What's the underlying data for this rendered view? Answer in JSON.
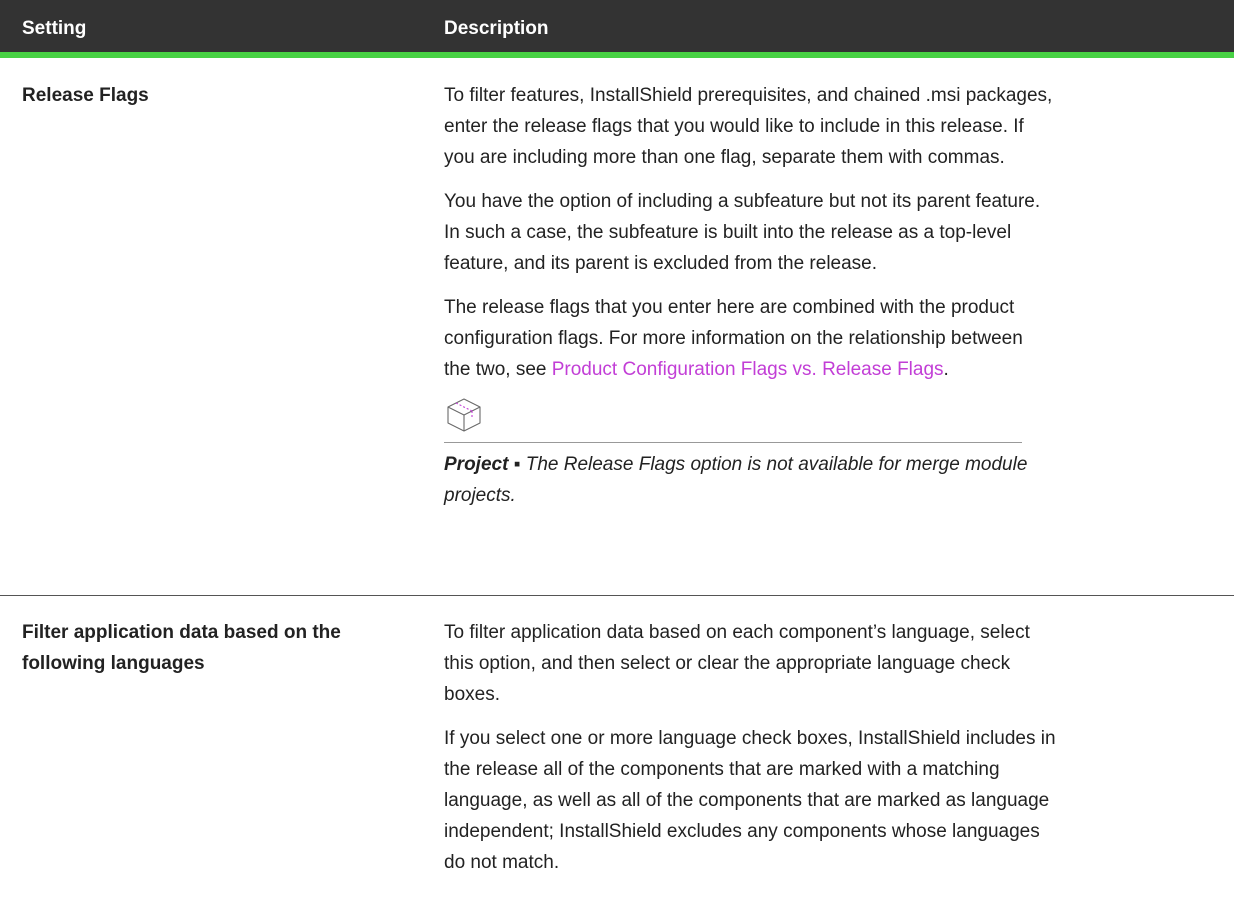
{
  "header": {
    "setting": "Setting",
    "description": "Description"
  },
  "colors": {
    "header_bg": "#333333",
    "header_accent": "#48d144",
    "link": "#c23ed6"
  },
  "rows": [
    {
      "setting": "Release Flags",
      "paragraphs": [
        {
          "lines": [
            "To filter features, InstallShield prerequisites, and chained .msi packages,",
            "enter the release flags that you would like to include in this release. If",
            "you are including more than one flag, separate them with commas."
          ]
        },
        {
          "lines": [
            "You have the option of including a subfeature but not its parent feature.",
            "In such a case, the subfeature is built into the release as a top-level",
            "feature, and its parent is excluded from the release."
          ]
        },
        {
          "lines": [
            "The release flags that you enter here are combined with the product",
            "configuration flags. For more information on the relationship between",
            "the two, see "
          ],
          "link_text": "Product Configuration Flags vs. Release Flags",
          "after_link": "."
        }
      ],
      "note": {
        "icon": "project-box-icon",
        "label": "Project ▪",
        "text_line1": " The Release Flags option is not available for merge module",
        "text_line2": "projects."
      }
    },
    {
      "setting_line1": "Filter application data based on the",
      "setting_line2": "following languages",
      "paragraphs": [
        {
          "lines": [
            "To filter application data based on each component’s language, select",
            "this option, and then select or clear the appropriate language check",
            "boxes."
          ]
        },
        {
          "lines": [
            "If you select one or more language check boxes, InstallShield includes in",
            "the release all of the components that are marked with a matching",
            "language, as well as all of the components that are marked as language",
            "independent; InstallShield excludes any components whose languages",
            "do not match."
          ]
        }
      ]
    }
  ]
}
